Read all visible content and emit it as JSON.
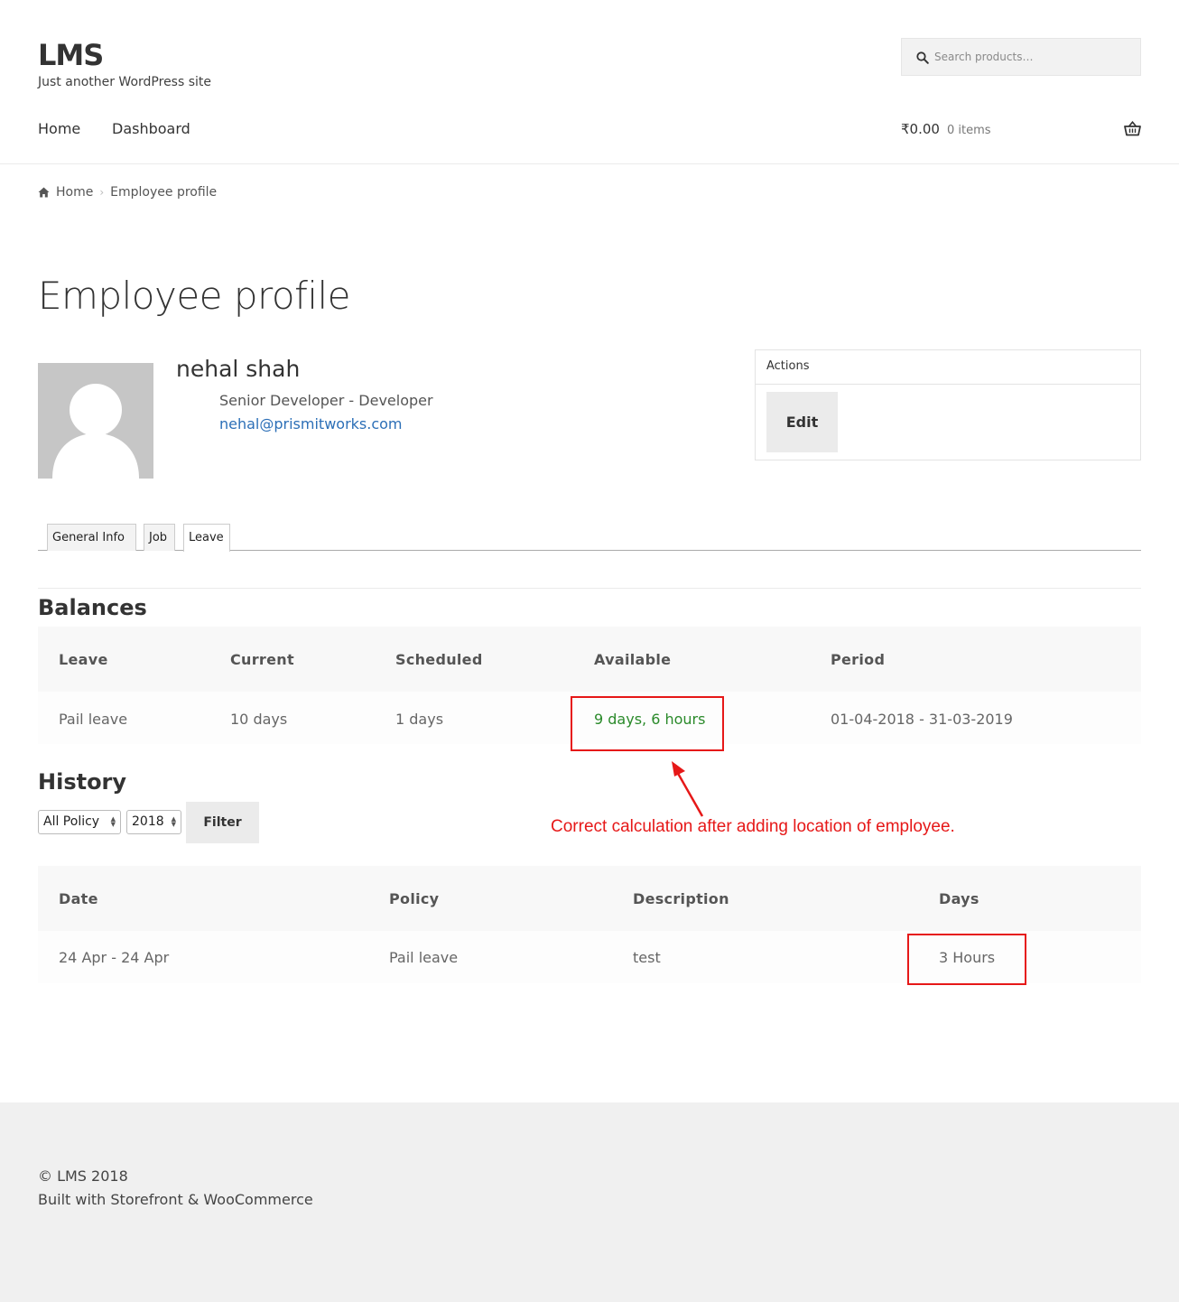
{
  "site": {
    "title": "LMS",
    "tagline": "Just another WordPress site"
  },
  "search": {
    "placeholder": "Search products…"
  },
  "nav": {
    "items": [
      {
        "label": "Home"
      },
      {
        "label": "Dashboard"
      }
    ]
  },
  "cart": {
    "amount": "₹0.00",
    "count": "0 items"
  },
  "breadcrumb": {
    "home": "Home",
    "current": "Employee profile"
  },
  "page": {
    "title": "Employee profile"
  },
  "employee": {
    "name": "nehal shah",
    "role": "Senior Developer - Developer",
    "email": "nehal@prismitworks.com"
  },
  "actions": {
    "title": "Actions",
    "edit_label": "Edit"
  },
  "tabs": [
    {
      "label": "General Info",
      "active": false
    },
    {
      "label": "Job",
      "active": false
    },
    {
      "label": "Leave",
      "active": true
    }
  ],
  "balances": {
    "title": "Balances",
    "headers": [
      "Leave",
      "Current",
      "Scheduled",
      "Available",
      "Period"
    ],
    "rows": [
      [
        "Pail leave",
        "10 days",
        "1 days",
        "9 days, 6 hours",
        "01-04-2018 - 31-03-2019"
      ]
    ]
  },
  "history": {
    "title": "History",
    "policy_select": "All Policy",
    "year_select": "2018",
    "filter_label": "Filter",
    "headers": [
      "Date",
      "Policy",
      "Description",
      "Days"
    ],
    "rows": [
      [
        "24 Apr - 24 Apr",
        "Pail leave",
        "test",
        "3 Hours"
      ]
    ]
  },
  "annotation": {
    "text": "Correct calculation after adding location of employee."
  },
  "footer": {
    "copyright": "© LMS 2018",
    "credit": "Built with Storefront & WooCommerce"
  },
  "colors": {
    "link": "#2c6fb7",
    "available": "#2a8a2a",
    "annotation": "#e61818"
  }
}
